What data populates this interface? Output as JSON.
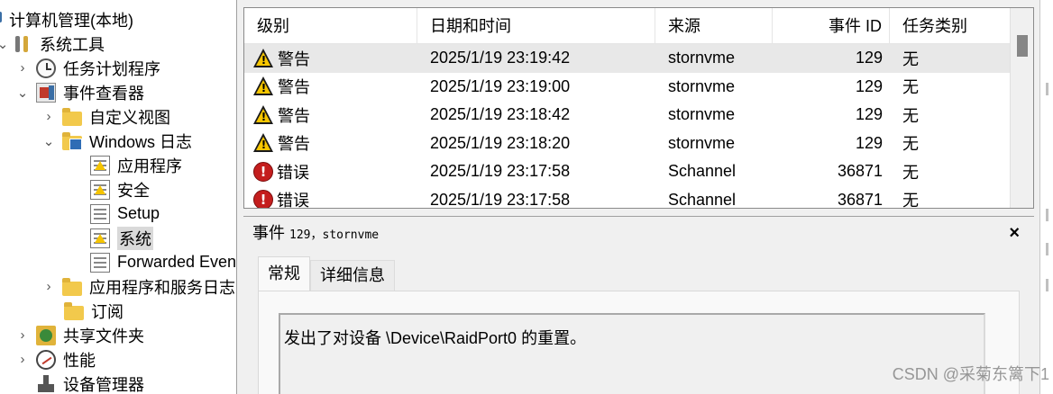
{
  "tree": {
    "root": "计算机管理(本地)",
    "system_tools": "系统工具",
    "task_scheduler": "任务计划程序",
    "event_viewer": "事件查看器",
    "custom_views": "自定义视图",
    "windows_logs": "Windows 日志",
    "application": "应用程序",
    "security": "安全",
    "setup": "Setup",
    "system": "系统",
    "forwarded_events": "Forwarded Even",
    "app_service_logs": "应用程序和服务日志",
    "subscriptions": "订阅",
    "shared_folders": "共享文件夹",
    "performance": "性能",
    "device_manager": "设备管理器"
  },
  "event_list": {
    "columns": {
      "level": "级别",
      "datetime": "日期和时间",
      "source": "来源",
      "event_id": "事件 ID",
      "task_category": "任务类别"
    },
    "rows": [
      {
        "icon": "warning-icon",
        "level": "警告",
        "datetime": "2025/1/19 23:19:42",
        "source": "stornvme",
        "event_id": "129",
        "task_category": "无"
      },
      {
        "icon": "warning-icon",
        "level": "警告",
        "datetime": "2025/1/19 23:19:00",
        "source": "stornvme",
        "event_id": "129",
        "task_category": "无"
      },
      {
        "icon": "warning-icon",
        "level": "警告",
        "datetime": "2025/1/19 23:18:42",
        "source": "stornvme",
        "event_id": "129",
        "task_category": "无"
      },
      {
        "icon": "warning-icon",
        "level": "警告",
        "datetime": "2025/1/19 23:18:20",
        "source": "stornvme",
        "event_id": "129",
        "task_category": "无"
      },
      {
        "icon": "error-icon",
        "level": "错误",
        "datetime": "2025/1/19 23:17:58",
        "source": "Schannel",
        "event_id": "36871",
        "task_category": "无"
      },
      {
        "icon": "error-icon",
        "level": "错误",
        "datetime": "2025/1/19 23:17:58",
        "source": "Schannel",
        "event_id": "36871",
        "task_category": "无"
      }
    ]
  },
  "detail": {
    "title_prefix": "事件",
    "title_info": "129，stornvme",
    "close": "×",
    "tabs": [
      "常规",
      "详细信息"
    ],
    "message": "发出了对设备 \\Device\\RaidPort0 的重置。"
  },
  "watermark": "CSDN @采菊东篱下1"
}
